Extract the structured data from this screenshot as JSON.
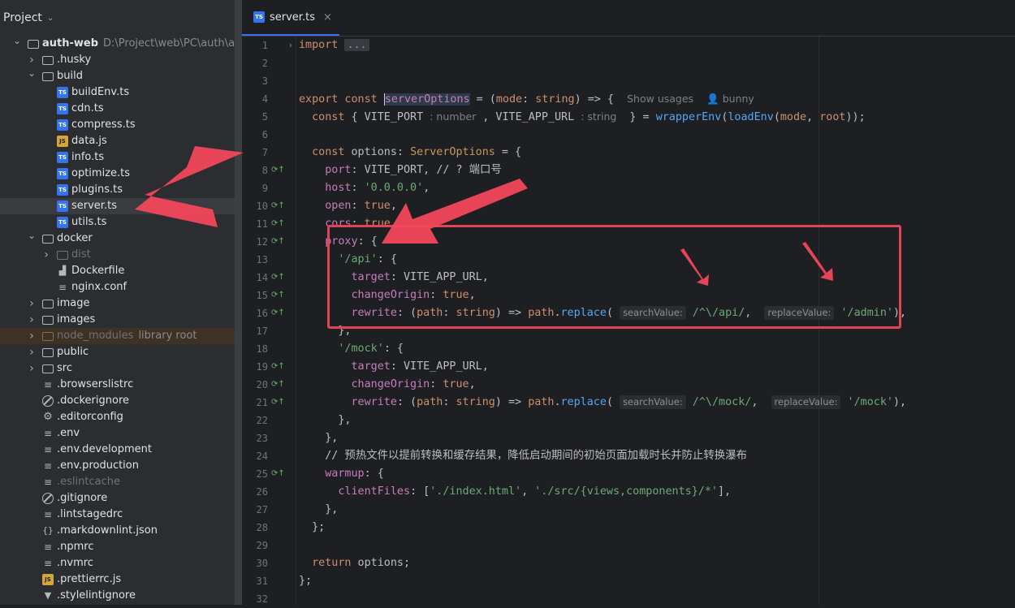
{
  "project_panel": {
    "title": "Project",
    "tree": [
      {
        "label": "auth-web",
        "path": "D:\\Project\\web\\PC\\auth\\auth-web",
        "kind": "folder",
        "depth": 0,
        "arrow": "open",
        "bold": true
      },
      {
        "label": ".husky",
        "kind": "folder",
        "depth": 1,
        "arrow": "closed"
      },
      {
        "label": "build",
        "kind": "folder",
        "depth": 1,
        "arrow": "open"
      },
      {
        "label": "buildEnv.ts",
        "kind": "ts",
        "depth": 2
      },
      {
        "label": "cdn.ts",
        "kind": "ts",
        "depth": 2
      },
      {
        "label": "compress.ts",
        "kind": "ts",
        "depth": 2
      },
      {
        "label": "data.js",
        "kind": "js",
        "depth": 2
      },
      {
        "label": "info.ts",
        "kind": "ts",
        "depth": 2
      },
      {
        "label": "optimize.ts",
        "kind": "ts",
        "depth": 2
      },
      {
        "label": "plugins.ts",
        "kind": "ts",
        "depth": 2
      },
      {
        "label": "server.ts",
        "kind": "ts",
        "depth": 2,
        "selected": true
      },
      {
        "label": "utils.ts",
        "kind": "ts",
        "depth": 2
      },
      {
        "label": "docker",
        "kind": "folder",
        "depth": 1,
        "arrow": "open"
      },
      {
        "label": "dist",
        "kind": "folder",
        "depth": 2,
        "arrow": "closed",
        "dim": true
      },
      {
        "label": "Dockerfile",
        "kind": "docker",
        "depth": 2
      },
      {
        "label": "nginx.conf",
        "kind": "text",
        "depth": 2
      },
      {
        "label": "image",
        "kind": "folder",
        "depth": 1,
        "arrow": "closed"
      },
      {
        "label": "images",
        "kind": "folder",
        "depth": 1,
        "arrow": "closed"
      },
      {
        "label": "node_modules",
        "lib": "library root",
        "kind": "folder",
        "depth": 1,
        "arrow": "closed",
        "excluded": true
      },
      {
        "label": "public",
        "kind": "folder",
        "depth": 1,
        "arrow": "closed"
      },
      {
        "label": "src",
        "kind": "folder",
        "depth": 1,
        "arrow": "closed"
      },
      {
        "label": ".browserslistrc",
        "kind": "text",
        "depth": 1
      },
      {
        "label": ".dockerignore",
        "kind": "ignore",
        "depth": 1
      },
      {
        "label": ".editorconfig",
        "kind": "gear",
        "depth": 1
      },
      {
        "label": ".env",
        "kind": "text",
        "depth": 1
      },
      {
        "label": ".env.development",
        "kind": "text",
        "depth": 1
      },
      {
        "label": ".env.production",
        "kind": "text",
        "depth": 1
      },
      {
        "label": ".eslintcache",
        "kind": "text",
        "depth": 1,
        "dim": true
      },
      {
        "label": ".gitignore",
        "kind": "ignore",
        "depth": 1
      },
      {
        "label": ".lintstagedrc",
        "kind": "text",
        "depth": 1
      },
      {
        "label": ".markdownlint.json",
        "kind": "json",
        "depth": 1
      },
      {
        "label": ".npmrc",
        "kind": "text",
        "depth": 1
      },
      {
        "label": ".nvmrc",
        "kind": "text",
        "depth": 1
      },
      {
        "label": ".prettierrc.js",
        "kind": "js",
        "depth": 1
      },
      {
        "label": ".stylelintignore",
        "kind": "style",
        "depth": 1
      }
    ]
  },
  "editor": {
    "tab_label": "server.ts",
    "tab_close": "×",
    "lines": [
      {
        "n": "1",
        "fold": "›",
        "html": "<span class='k'>import</span> <span class='collapsed'>...</span>"
      },
      {
        "n": "2",
        "html": ""
      },
      {
        "n": "3",
        "html": ""
      },
      {
        "n": "4",
        "html": "<span class='k'>export const</span> <span class='cursor'></span><span style='color:#c77dbb;background:#2d3a4a'>serverOptions</span> = (<span class='pa'>mode</span>: <span class='k'>string</span>) => {  <span class='inlay'>Show usages</span>  <span class='inlay'>&#128100; bunny</span>"
      },
      {
        "n": "5",
        "html": "  <span class='k'>const</span> { VITE_PORT <span class='inlay'>: number</span> , VITE_APP_URL <span class='inlay'>: string</span>  } = <span class='f'>wrapperEnv</span>(<span class='f'>loadEnv</span>(<span class='pa'>mode</span>, <span class='pa'>root</span>));"
      },
      {
        "n": "6",
        "html": ""
      },
      {
        "n": "7",
        "html": "  <span class='k'>const</span> options: <span class='tyc'>ServerOptions</span> = {"
      },
      {
        "n": "8",
        "mark": "⟳↑",
        "html": "    <span class='p'>port</span>: VITE_PORT, <span class='cm'>// ? 端口号</span>"
      },
      {
        "n": "9",
        "html": "    <span class='p'>host</span>: <span class='s'>'0.0.0.0'</span>,"
      },
      {
        "n": "10",
        "mark": "⟳↑",
        "html": "    <span class='p'>open</span>: <span class='k'>true</span>,"
      },
      {
        "n": "11",
        "mark": "⟳↑",
        "html": "    <span class='p'>cors</span>: <span class='k'>true</span>,"
      },
      {
        "n": "12",
        "mark": "⟳↑",
        "html": "    <span class='p'>proxy</span>: {"
      },
      {
        "n": "13",
        "html": "      <span class='s'>'/api'</span>: {"
      },
      {
        "n": "14",
        "mark": "⟳↑",
        "html": "        <span class='p'>target</span>: VITE_APP_URL,"
      },
      {
        "n": "15",
        "mark": "⟳↑",
        "html": "        <span class='p'>changeOrigin</span>: <span class='k'>true</span>,"
      },
      {
        "n": "16",
        "mark": "⟳↑",
        "html": "        <span class='p'>rewrite</span>: (<span class='pa'>path</span>: <span class='k'>string</span>) => <span class='pa'>path</span>.<span class='f'>replace</span>( <span class='hint'>searchValue:</span> <span class='s'>/^\\/api/</span>,  <span class='hint'>replaceValue:</span> <span class='s'>'/admin'</span>),"
      },
      {
        "n": "17",
        "html": "      },"
      },
      {
        "n": "18",
        "html": "      <span class='s'>'/mock'</span>: {"
      },
      {
        "n": "19",
        "mark": "⟳↑",
        "html": "        <span class='p'>target</span>: VITE_APP_URL,"
      },
      {
        "n": "20",
        "mark": "⟳↑",
        "html": "        <span class='p'>changeOrigin</span>: <span class='k'>true</span>,"
      },
      {
        "n": "21",
        "mark": "⟳↑",
        "html": "        <span class='p'>rewrite</span>: (<span class='pa'>path</span>: <span class='k'>string</span>) => <span class='pa'>path</span>.<span class='f'>replace</span>( <span class='hint'>searchValue:</span> <span class='s'>/^\\/mock/</span>,  <span class='hint'>replaceValue:</span> <span class='s'>'/mock'</span>),"
      },
      {
        "n": "22",
        "html": "      },"
      },
      {
        "n": "23",
        "html": "    },"
      },
      {
        "n": "24",
        "html": "    <span class='cm'>// 预热文件以提前转换和缓存结果，降低启动期间的初始页面加载时长并防止转换瀑布</span>"
      },
      {
        "n": "25",
        "mark": "⟳↑",
        "html": "    <span class='p'>warmup</span>: {"
      },
      {
        "n": "26",
        "html": "      <span class='p'>clientFiles</span>: [<span class='s'>'./index.html'</span>, <span class='s'>'./src/{views,components}/*'</span>],"
      },
      {
        "n": "27",
        "html": "    },"
      },
      {
        "n": "28",
        "html": "  };"
      },
      {
        "n": "29",
        "html": ""
      },
      {
        "n": "30",
        "html": "  <span class='k'>return</span> options;"
      },
      {
        "n": "31",
        "html": "};"
      },
      {
        "n": "32",
        "html": ""
      }
    ]
  },
  "colors": {
    "accent": "#3574f0",
    "annotation": "#f2475b"
  }
}
